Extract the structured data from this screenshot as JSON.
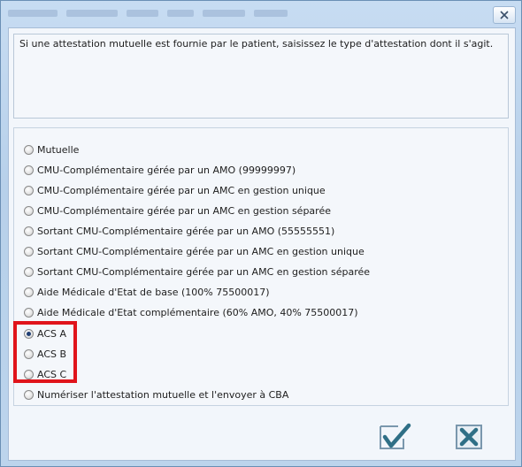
{
  "dialog": {
    "instruction": "Si une attestation mutuelle est fournie par le patient, saisissez le type d'attestation dont il s'agit.",
    "options": [
      {
        "label": "Mutuelle",
        "checked": false
      },
      {
        "label": "CMU-Complémentaire gérée par un AMO (99999997)",
        "checked": false
      },
      {
        "label": "CMU-Complémentaire gérée par un AMC en gestion unique",
        "checked": false
      },
      {
        "label": "CMU-Complémentaire gérée par un AMC en gestion séparée",
        "checked": false
      },
      {
        "label": "Sortant CMU-Complémentaire gérée par un AMO (55555551)",
        "checked": false
      },
      {
        "label": "Sortant CMU-Complémentaire gérée par un AMC en gestion unique",
        "checked": false
      },
      {
        "label": "Sortant CMU-Complémentaire gérée par un AMC en gestion séparée",
        "checked": false
      },
      {
        "label": "Aide Médicale d'Etat de base (100% 75500017)",
        "checked": false
      },
      {
        "label": "Aide Médicale d'Etat complémentaire (60% AMO, 40% 75500017)",
        "checked": false
      },
      {
        "label": "ACS A",
        "checked": true
      },
      {
        "label": "ACS B",
        "checked": false
      },
      {
        "label": "ACS C",
        "checked": false
      },
      {
        "label": "Numériser l'attestation mutuelle et l'envoyer à CBA",
        "checked": false
      }
    ],
    "buttons": {
      "ok_icon": "checkmark-icon",
      "cancel_icon": "x-icon"
    },
    "colors": {
      "highlight": "#e0141b",
      "checkmark": "#2f6f86",
      "cancel": "#2f6f86"
    }
  }
}
